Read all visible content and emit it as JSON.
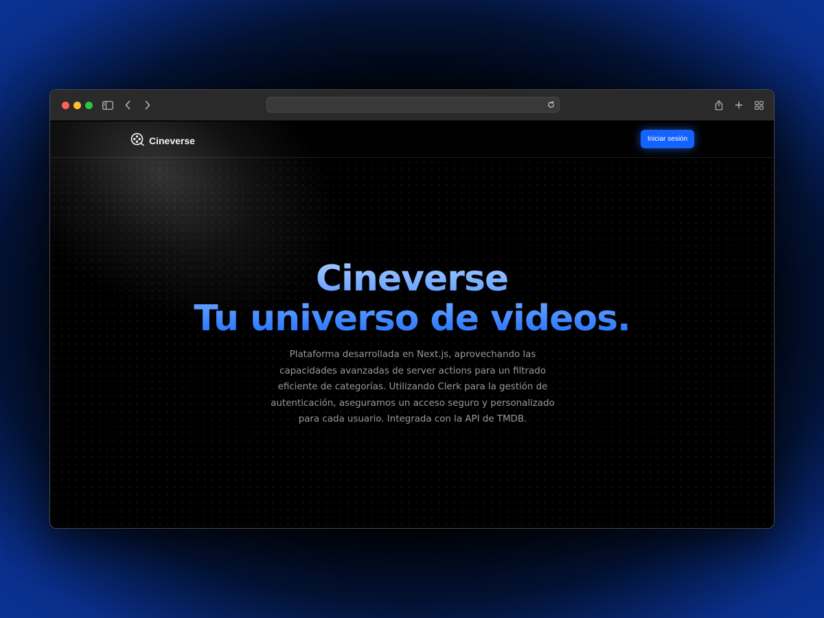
{
  "browser": {
    "url": "",
    "icons": {
      "sidebar": "sidebar-toggle-icon",
      "back": "chevron-left-icon",
      "forward": "chevron-right-icon",
      "reload": "reload-icon",
      "share": "share-icon",
      "new_tab": "plus-icon",
      "tabs": "tab-overview-icon"
    }
  },
  "site": {
    "brand": {
      "name": "Cineverse",
      "icon": "film-reel-icon"
    },
    "nav": {
      "login_label": "Iniciar sesión"
    },
    "hero": {
      "title_line1": "Cineverse",
      "title_line2": "Tu universo de videos.",
      "description": "Plataforma desarrollada en Next.js, aprovechando las capacidades avanzadas de server actions para un filtrado eficiente de categorías. Utilizando Clerk para la gestión de autenticación, aseguramos un acceso seguro y personalizado para cada usuario. Integrada con la API de TMDB."
    }
  },
  "colors": {
    "accent": "#1463ff",
    "title_light": "#a8cbff",
    "title_dark": "#1f6dff",
    "backdrop": "#0b3296",
    "page_background": "#000000",
    "text_muted": "#9a9a9a"
  }
}
